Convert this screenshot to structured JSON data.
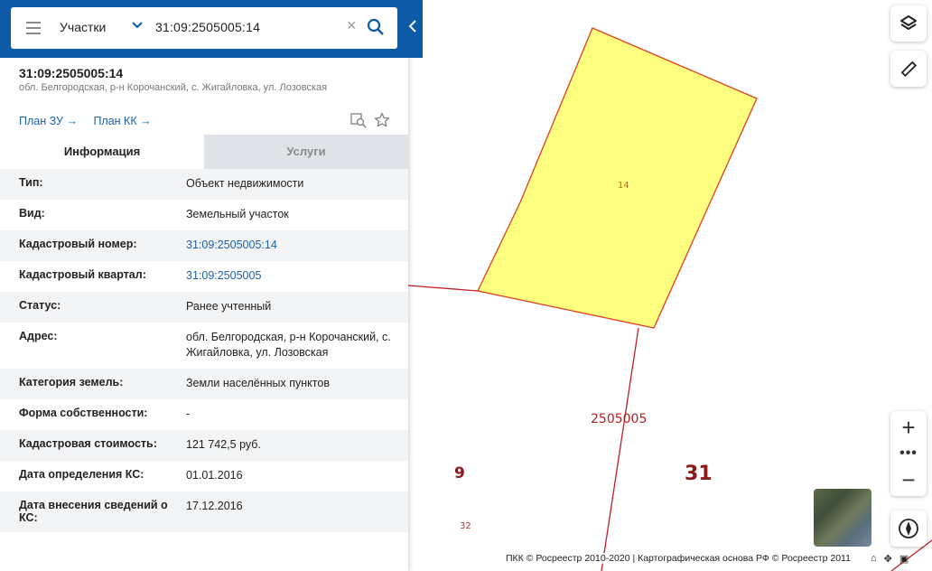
{
  "search": {
    "category": "Участки",
    "query": "31:09:2505005:14"
  },
  "object": {
    "number": "31:09:2505005:14",
    "address": "обл. Белгородская, р-н Корочанский, с. Жигайловка, ул. Лозовская",
    "links": [
      "План ЗУ",
      "План КК"
    ]
  },
  "tabs": [
    "Информация",
    "Услуги"
  ],
  "info_rows": [
    {
      "key": "Тип:",
      "value": "Объект недвижимости"
    },
    {
      "key": "Вид:",
      "value": "Земельный участок"
    },
    {
      "key": "Кадастровый номер:",
      "value": "31:09:2505005:14"
    },
    {
      "key": "Кадастровый квартал:",
      "value": "31:09:2505005"
    },
    {
      "key": "Статус:",
      "value": "Ранее учтенный"
    },
    {
      "key": "Адрес:",
      "value": "обл. Белгородская, р-н Корочанский, с. Жигайловка, ул. Лозовская"
    },
    {
      "key": "Категория земель:",
      "value": "Земли населённых пунктов"
    },
    {
      "key": "Форма собственности:",
      "value": "-"
    },
    {
      "key": "Кадастровая стоимость:",
      "value": "121 742,5 руб."
    },
    {
      "key": "Дата определения КС:",
      "value": "01.01.2016"
    },
    {
      "key": "Дата внесения сведений о КС:",
      "value": "17.12.2016"
    }
  ],
  "map": {
    "parcel_label": "14",
    "block_label": "2505005",
    "district_left": "9",
    "district_right": "31",
    "small_label": "32",
    "attribution": "ПКК © Росреестр 2010-2020 | Картографическая основа РФ © Росреестр 2011",
    "zoom_in": "+",
    "zoom_more": "•••",
    "zoom_out": "−",
    "colors": {
      "parcel_fill": "#ffff80",
      "parcel_stroke": "#e04020",
      "boundary": "#c0202c"
    }
  },
  "icons": [
    "menu-icon",
    "chevron-down-icon",
    "clear-icon",
    "search-icon",
    "collapse-chevron-icon",
    "layers-icon",
    "ruler-icon",
    "compass-icon",
    "home-icon",
    "move-icon",
    "window-icon",
    "preview-icon",
    "star-icon"
  ]
}
